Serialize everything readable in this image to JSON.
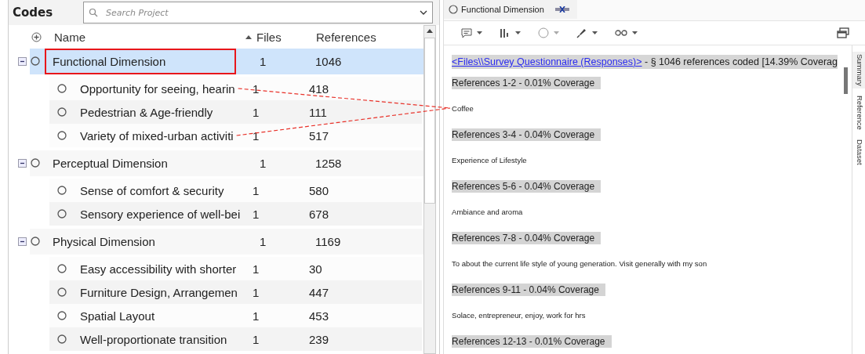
{
  "codes_panel": {
    "title": "Codes",
    "search": {
      "placeholder": "Search Project"
    },
    "columns": [
      "Name",
      "Files",
      "References"
    ],
    "nodes": [
      {
        "name": "Functional Dimension",
        "files": "1",
        "references": "1046",
        "expanded": true,
        "selected": true,
        "highlighted": true,
        "children": [
          {
            "name": "Opportunity for seeing, hearin",
            "files": "1",
            "references": "418",
            "linked": true
          },
          {
            "name": "Pedestrian & Age-friendly",
            "files": "1",
            "references": "111",
            "linked": false
          },
          {
            "name": "Variety of mixed-urban activiti",
            "files": "1",
            "references": "517",
            "linked": true
          }
        ]
      },
      {
        "name": "Perceptual Dimension",
        "files": "1",
        "references": "1258",
        "expanded": true,
        "selected": false,
        "highlighted": false,
        "children": [
          {
            "name": "Sense of comfort & security",
            "files": "1",
            "references": "580",
            "linked": false
          },
          {
            "name": "Sensory experience of well-bei",
            "files": "1",
            "references": "678",
            "linked": false
          }
        ]
      },
      {
        "name": "Physical Dimension",
        "files": "1",
        "references": "1169",
        "expanded": true,
        "selected": false,
        "highlighted": false,
        "children": [
          {
            "name": "Easy accessibility with shorter",
            "files": "1",
            "references": "30",
            "linked": false
          },
          {
            "name": "Furniture Design, Arrangemen",
            "files": "1",
            "references": "447",
            "linked": false
          },
          {
            "name": "Spatial Layout",
            "files": "1",
            "references": "453",
            "linked": false
          },
          {
            "name": "Well-proportionate transition",
            "files": "1",
            "references": "239",
            "linked": false
          }
        ]
      }
    ]
  },
  "detail_panel": {
    "tab": {
      "title": "Functional Dimension"
    },
    "header": {
      "link": "<Files\\\\Survey Questionnaire (Responses)>",
      "summary": " - § 1046 references coded  [14.39% Coverag"
    },
    "blocks": [
      {
        "kind": "heading",
        "text": "References 1-2 - 0.01% Coverage"
      },
      {
        "kind": "text",
        "text": "Coffee"
      },
      {
        "kind": "heading",
        "text": "References 3-4 - 0.04% Coverage"
      },
      {
        "kind": "text",
        "text": "Experience of Lifestyle"
      },
      {
        "kind": "heading",
        "text": "References 5-6 - 0.04% Coverage"
      },
      {
        "kind": "text",
        "text": "Ambiance and aroma"
      },
      {
        "kind": "heading",
        "text": "References 7-8 - 0.04% Coverage"
      },
      {
        "kind": "text",
        "text": "To about the current life style of young generation. Visit generally with my son"
      },
      {
        "kind": "heading",
        "text": "References 9-11 - 0.04% Coverage"
      },
      {
        "kind": "text",
        "text": "Solace, entrepreneur, enjoy, work for hrs"
      },
      {
        "kind": "heading",
        "text": "References 12-13 - 0.01% Coverage"
      }
    ],
    "side_tabs": [
      {
        "label": "Summary",
        "selected": true
      },
      {
        "label": "Reference",
        "selected": false
      },
      {
        "label": "Dataset",
        "selected": false
      }
    ]
  }
}
